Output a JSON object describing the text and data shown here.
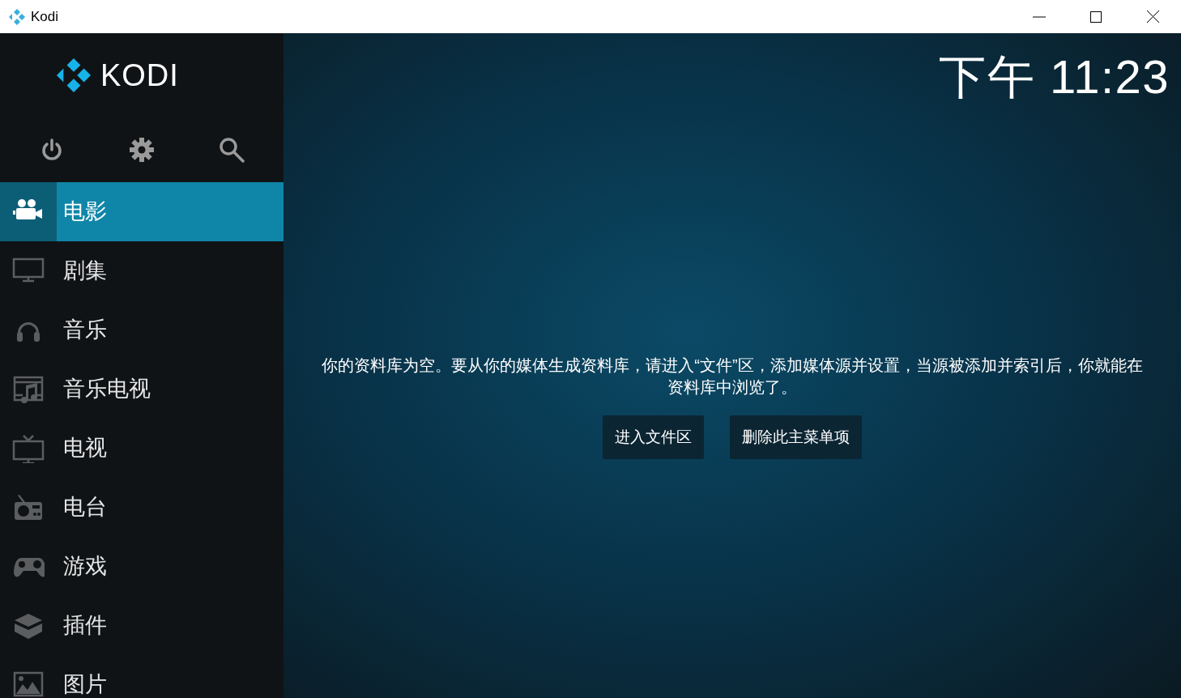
{
  "window": {
    "title": "Kodi"
  },
  "logo": {
    "text": "KODI"
  },
  "clock": "下午 11:23",
  "top_buttons": [
    {
      "kind": "power"
    },
    {
      "kind": "settings"
    },
    {
      "kind": "search"
    }
  ],
  "menu": [
    {
      "kind": "movies",
      "label": "电影",
      "selected": true
    },
    {
      "kind": "tvshows",
      "label": "剧集",
      "selected": false
    },
    {
      "kind": "music",
      "label": "音乐",
      "selected": false
    },
    {
      "kind": "musicvideos",
      "label": "音乐电视",
      "selected": false
    },
    {
      "kind": "tv",
      "label": "电视",
      "selected": false
    },
    {
      "kind": "radio",
      "label": "电台",
      "selected": false
    },
    {
      "kind": "games",
      "label": "游戏",
      "selected": false
    },
    {
      "kind": "addons",
      "label": "插件",
      "selected": false
    },
    {
      "kind": "pictures",
      "label": "图片",
      "selected": false
    }
  ],
  "message": "你的资料库为空。要从你的媒体生成资料库，请进入“文件”区，添加媒体源并设置，当源被添加并索引后，你就能在资料库中浏览了。",
  "buttons": [
    "进入文件区",
    "删除此主菜单项"
  ]
}
